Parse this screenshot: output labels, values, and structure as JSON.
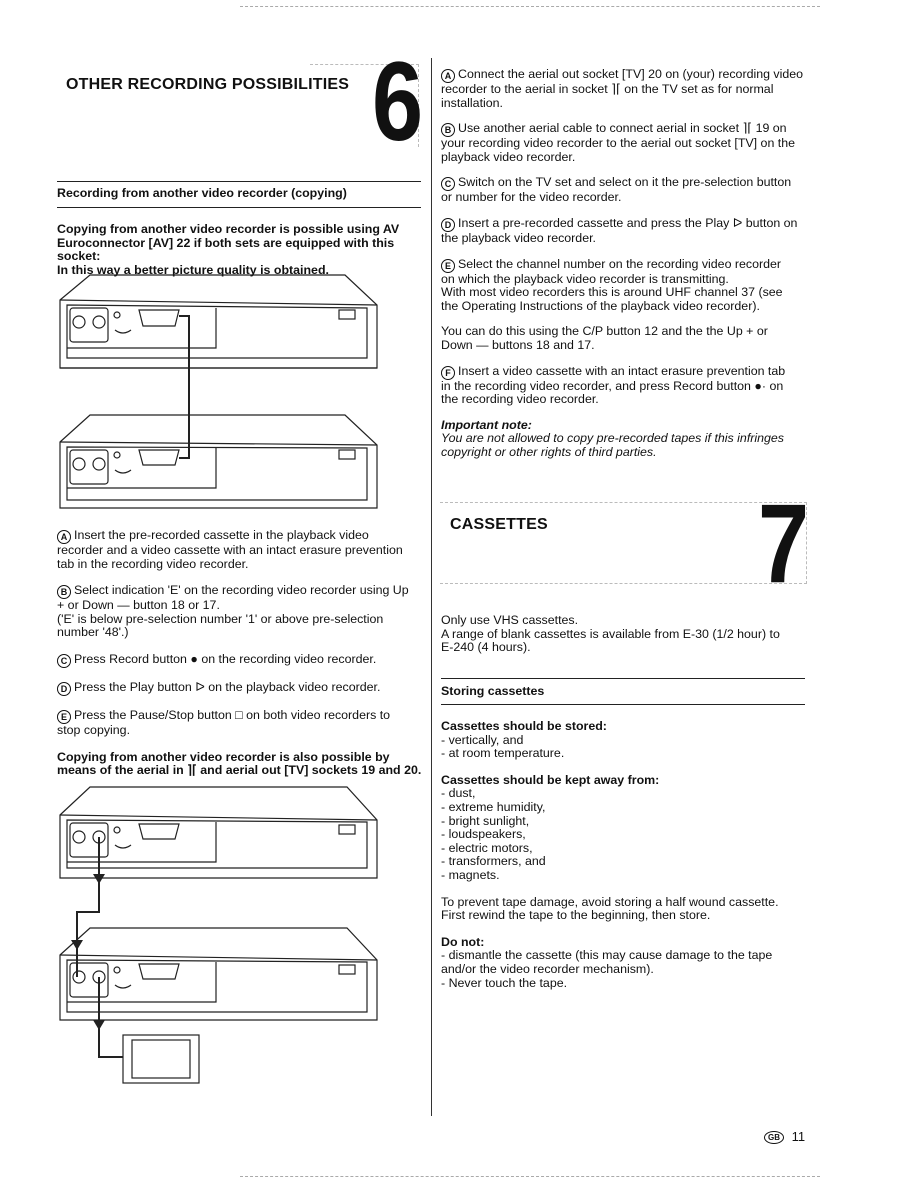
{
  "page": {
    "number": "11",
    "region_badge": "GB"
  },
  "chapter6": {
    "title": "OTHER RECORDING POSSIBILITIES",
    "number": "6",
    "section_heading": "Recording from another video recorder (copying)",
    "intro": "Copying from another video recorder is possible using AV Euroconnector ⒶⓋ 22 if both sets are equipped with this socket: In this way a better picture quality is obtained.",
    "intro_lines": [
      "Copying from another video recorder is possible using AV",
      "Euroconnector [AV] 22 if both sets are equipped with this socket:",
      "In this way a better picture quality is obtained."
    ],
    "steps_av": [
      {
        "letter": "A",
        "lines": [
          "Insert the pre-recorded cassette in the playback video",
          "recorder and a video cassette with an intact erasure prevention",
          "tab in the recording video recorder."
        ]
      },
      {
        "letter": "B",
        "lines": [
          "Select indication 'E' on the recording video recorder using Up",
          "+ or Down — button 18 or 17.",
          "('E' is below pre-selection number '1' or above pre-selection",
          "number '48'.)"
        ]
      },
      {
        "letter": "C",
        "lines": [
          "Press Record button ● on the recording video recorder."
        ]
      },
      {
        "letter": "D",
        "lines": [
          "Press the Play button ᐅ on the playback video recorder."
        ]
      },
      {
        "letter": "E",
        "lines": [
          "Press the Pause/Stop button □ on both video recorders to",
          "stop copying."
        ]
      }
    ],
    "aerial_intro_lines": [
      "Copying from another video recorder is also possible by",
      "means of the aerial in ⌉⌈ and aerial out [TV] sockets 19 and 20."
    ],
    "steps_aerial": [
      {
        "letter": "A",
        "lines": [
          "Connect the aerial out socket [TV] 20 on (your) recording video",
          "recorder to the aerial in socket ⌉⌈ on the TV set as for normal",
          "installation."
        ]
      },
      {
        "letter": "B",
        "lines": [
          "Use another aerial cable to connect aerial in socket ⌉⌈ 19 on",
          "your recording video recorder to the aerial out socket [TV] on the",
          "playback video recorder."
        ]
      },
      {
        "letter": "C",
        "lines": [
          "Switch on the TV set and select on it the pre-selection button",
          "or number for the video recorder."
        ]
      },
      {
        "letter": "D",
        "lines": [
          "Insert a pre-recorded cassette and press the Play ᐅ button on",
          "the playback video recorder."
        ]
      },
      {
        "letter": "E",
        "lines": [
          "Select the channel number on the recording video recorder",
          "on which the playback video recorder is transmitting.",
          "With most video recorders this is around UHF channel 37 (see",
          "the Operating Instructions of the playback video recorder)."
        ]
      }
    ],
    "cp_note_lines": [
      "You can do this using the C/P button 12 and the the Up + or",
      "Down — buttons 18 and 17."
    ],
    "step_f": {
      "letter": "F",
      "lines": [
        "Insert a video cassette with an intact erasure prevention tab",
        "in the recording video recorder, and press Record button ●· on",
        "the recording video recorder."
      ]
    },
    "important_note": {
      "label": "Important note:",
      "lines": [
        "You are not allowed to copy pre-recorded tapes if this infringes",
        "copyright or other rights of third parties."
      ]
    }
  },
  "chapter7": {
    "title": "CASSETTES",
    "number": "7",
    "intro_lines": [
      "Only use VHS cassettes.",
      "A range of blank cassettes is available from E-30 (1/2 hour) to",
      "E-240 (4 hours)."
    ],
    "section_heading": "Storing cassettes",
    "stored_heading": "Cassettes should be stored:",
    "stored_items": [
      "- vertically, and",
      "- at room temperature."
    ],
    "away_heading": "Cassettes should be kept away from:",
    "away_items": [
      "- dust,",
      "- extreme humidity,",
      "- bright sunlight,",
      "- loudspeakers,",
      "- electric motors,",
      "- transformers, and",
      "- magnets."
    ],
    "damage_lines": [
      "To prevent tape damage, avoid storing a half wound cassette.",
      "First rewind the tape to the beginning, then store."
    ],
    "donot_heading": "Do not:",
    "donot_items": [
      "- dismantle the cassette (this may cause damage to the tape",
      "  and/or the video recorder mechanism).",
      "- Never touch the tape."
    ]
  },
  "figures": {
    "fig1": "two-vcrs-connected-by-euroconnector",
    "fig2": "two-vcrs-and-tv-connected-by-aerial-cables"
  }
}
